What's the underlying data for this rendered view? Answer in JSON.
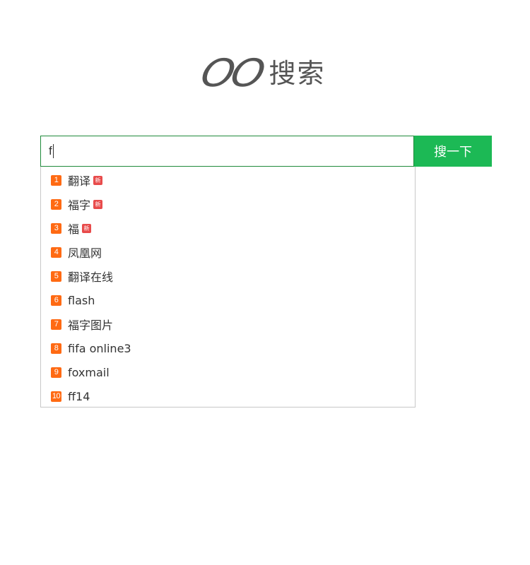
{
  "logo": {
    "mark": "OO",
    "text": "搜索"
  },
  "search": {
    "value": "f",
    "button_label": "搜一下"
  },
  "suggestions": [
    {
      "rank": "1",
      "text": "翻译",
      "new_badge": "新"
    },
    {
      "rank": "2",
      "text": "福字",
      "new_badge": "新"
    },
    {
      "rank": "3",
      "text": "福",
      "new_badge": "新"
    },
    {
      "rank": "4",
      "text": "凤凰网"
    },
    {
      "rank": "5",
      "text": "翻译在线"
    },
    {
      "rank": "6",
      "text": "flash"
    },
    {
      "rank": "7",
      "text": "福字图片"
    },
    {
      "rank": "8",
      "text": "fifa online3"
    },
    {
      "rank": "9",
      "text": "foxmail"
    },
    {
      "rank": "10",
      "text": "ff14"
    }
  ],
  "colors": {
    "accent": "#1cb955",
    "input_border": "#1f8a3a",
    "rank_badge": "#ff6a13",
    "new_badge": "#e84b4b"
  }
}
